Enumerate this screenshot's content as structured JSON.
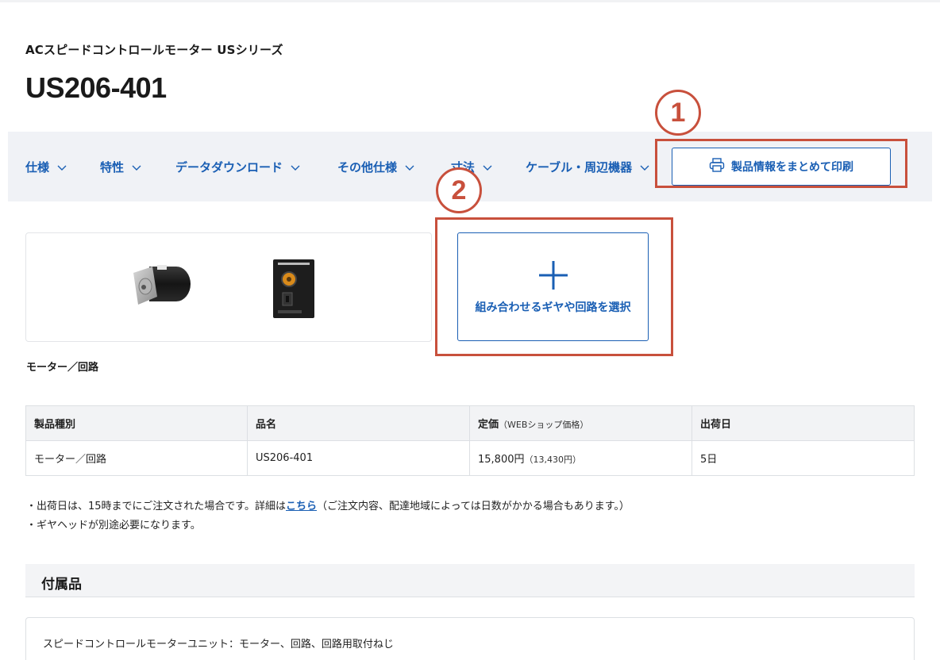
{
  "header": {
    "series": "ACスピードコントロールモーター USシリーズ",
    "model": "US206-401"
  },
  "nav": {
    "items": [
      {
        "label": "仕様"
      },
      {
        "label": "特性"
      },
      {
        "label": "データダウンロード"
      },
      {
        "label": "その他仕様"
      },
      {
        "label": "寸法"
      },
      {
        "label": "ケーブル・周辺機器"
      }
    ],
    "print_label": "製品情報をまとめて印刷"
  },
  "annotations": {
    "one": "1",
    "two": "2",
    "color": "#c8503c"
  },
  "product": {
    "select_label": "組み合わせるギヤや回路を選択",
    "caption": "モーター／回路"
  },
  "table": {
    "headers": {
      "type": "製品種別",
      "name": "品名",
      "price": "定価",
      "price_note": "（WEBショップ価格）",
      "ship": "出荷日"
    },
    "row": {
      "type": "モーター／回路",
      "name": "US206-401",
      "price": "15,800円",
      "price_web": "（13,430円）",
      "ship": "5日"
    }
  },
  "notes": {
    "line1_prefix": "・出荷日は、15時までにご注文された場合です。詳細は",
    "line1_link": "こちら",
    "line1_suffix": "（ご注文内容、配達地域によっては日数がかかる場合もあります。）",
    "line2": "・ギヤヘッドが別途必要になります。"
  },
  "accessories": {
    "title": "付属品",
    "text": "スピードコントロールモーターユニット：モーター、回路、回路用取付ねじ"
  },
  "colors": {
    "link": "#1a5fb4",
    "nav_bg": "#f0f2f6",
    "annotation": "#c8503c"
  }
}
